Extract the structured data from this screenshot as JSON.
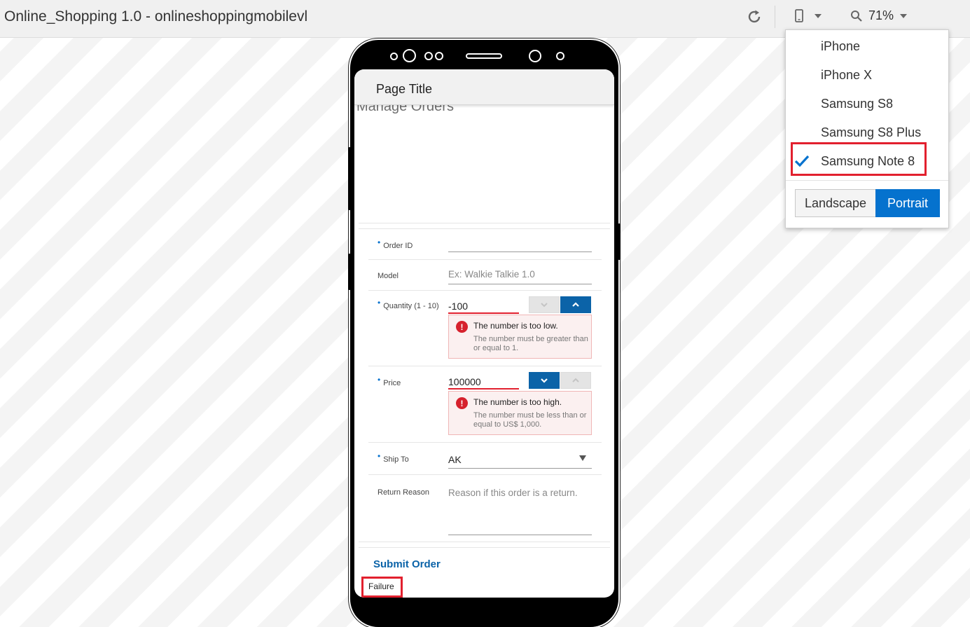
{
  "app": {
    "title": "Online_Shopping 1.0 - onlineshoppingmobilevl"
  },
  "toolbar": {
    "zoom": "71%"
  },
  "device_menu": {
    "items": [
      {
        "label": "iPhone",
        "selected": false
      },
      {
        "label": "iPhone X",
        "selected": false
      },
      {
        "label": "Samsung S8",
        "selected": false
      },
      {
        "label": "Samsung S8 Plus",
        "selected": false
      },
      {
        "label": "Samsung Note 8",
        "selected": true
      }
    ],
    "orientation": {
      "landscape": "Landscape",
      "portrait": "Portrait",
      "active": "Portrait"
    }
  },
  "page": {
    "title": "Page Title",
    "section_title": "Manage Orders"
  },
  "form": {
    "order_id": {
      "label": "Order ID",
      "required": true,
      "value": ""
    },
    "model": {
      "label": "Model",
      "required": false,
      "placeholder": "Ex: Walkie Talkie 1.0"
    },
    "quantity": {
      "label": "Quantity (1 - 10)",
      "required": true,
      "value": "-100",
      "error_title": "The number is too low.",
      "error_detail": "The number must be greater than or equal to 1."
    },
    "price": {
      "label": "Price",
      "required": true,
      "value": "100000",
      "error_title": "The number is too high.",
      "error_detail": "The number must be less than or equal to US$ 1,000."
    },
    "ship_to": {
      "label": "Ship To",
      "required": true,
      "value": "AK"
    },
    "return_reason": {
      "label": "Return Reason",
      "required": false,
      "placeholder": "Reason if this order is a return."
    }
  },
  "actions": {
    "submit": "Submit Order"
  },
  "status": {
    "text": "Failure"
  },
  "colors": {
    "accent": "#0572ce",
    "error": "#e2202e",
    "link": "#0b63a8"
  }
}
